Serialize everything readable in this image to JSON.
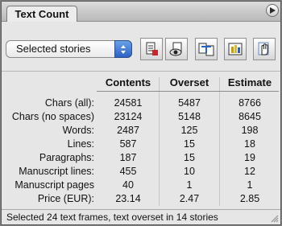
{
  "panel": {
    "tab_title": "Text Count"
  },
  "toolbar": {
    "selection": "Selected stories",
    "tools": [
      {
        "name": "document-icon"
      },
      {
        "name": "view-icon"
      },
      {
        "name": "text-frame-icon"
      },
      {
        "name": "bar-chart-icon"
      },
      {
        "name": "hand-icon"
      }
    ]
  },
  "table": {
    "headers": [
      "Contents",
      "Overset",
      "Estimate"
    ],
    "rows": [
      {
        "label": "Chars (all):",
        "contents": "24581",
        "overset": "5487",
        "estimate": "8766"
      },
      {
        "label": "Chars (no spaces)",
        "contents": "23124",
        "overset": "5148",
        "estimate": "8645"
      },
      {
        "label": "Words:",
        "contents": "2487",
        "overset": "125",
        "estimate": "198"
      },
      {
        "label": "Lines:",
        "contents": "587",
        "overset": "15",
        "estimate": "18"
      },
      {
        "label": "Paragraphs:",
        "contents": "187",
        "overset": "15",
        "estimate": "19"
      },
      {
        "label": "Manuscript lines:",
        "contents": "455",
        "overset": "10",
        "estimate": "12"
      },
      {
        "label": "Manuscript pages",
        "contents": "40",
        "overset": "1",
        "estimate": "1"
      },
      {
        "label": "Price (EUR):",
        "contents": "23.14",
        "overset": "2.47",
        "estimate": "2.85"
      }
    ]
  },
  "status": {
    "text": "Selected 24 text frames, text overset in 14 stories"
  }
}
